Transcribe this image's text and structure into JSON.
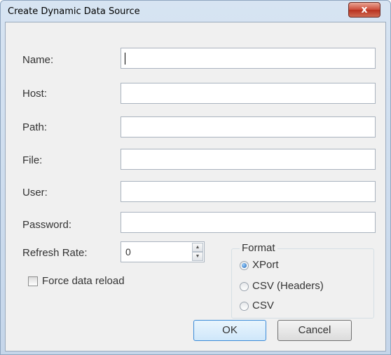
{
  "window": {
    "title": "Create Dynamic Data Source",
    "close_glyph": "x"
  },
  "form": {
    "fields": [
      {
        "label": "Name:",
        "value": ""
      },
      {
        "label": "Host:",
        "value": ""
      },
      {
        "label": "Path:",
        "value": ""
      },
      {
        "label": "File:",
        "value": ""
      },
      {
        "label": "User:",
        "value": ""
      },
      {
        "label": "Password:",
        "value": ""
      }
    ],
    "refresh_rate": {
      "label": "Refresh Rate:",
      "value": "0"
    },
    "force_reload": {
      "label": "Force data reload",
      "checked": false
    }
  },
  "format": {
    "title": "Format",
    "options": [
      {
        "label": "XPort",
        "selected": true
      },
      {
        "label": "CSV (Headers)",
        "selected": false
      },
      {
        "label": "CSV",
        "selected": false
      }
    ]
  },
  "buttons": {
    "ok": "OK",
    "cancel": "Cancel"
  },
  "colors": {
    "close_button": "#c9452f",
    "default_button_border": "#3c8bd8",
    "radio_dot": "#1b5fb3"
  }
}
